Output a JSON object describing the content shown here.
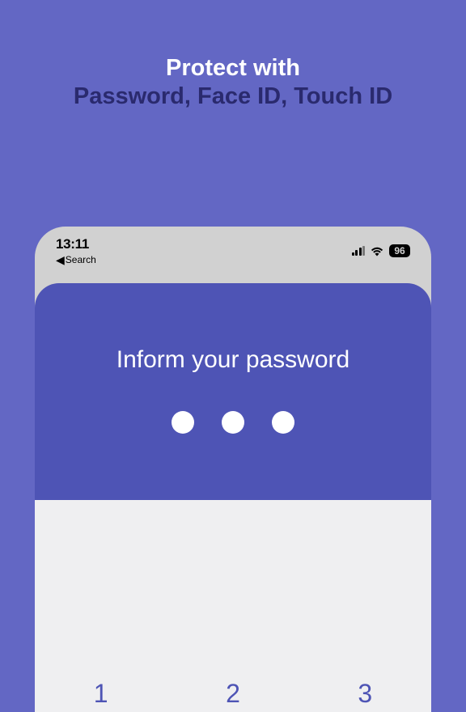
{
  "marketing": {
    "line1": "Protect with",
    "line2": "Password, Face ID, Touch ID"
  },
  "status_bar": {
    "time": "13:11",
    "back_label": "Search",
    "battery": "96"
  },
  "lock_screen": {
    "title": "Inform your password"
  },
  "keypad": {
    "keys_row1": [
      "1",
      "2",
      "3"
    ]
  }
}
